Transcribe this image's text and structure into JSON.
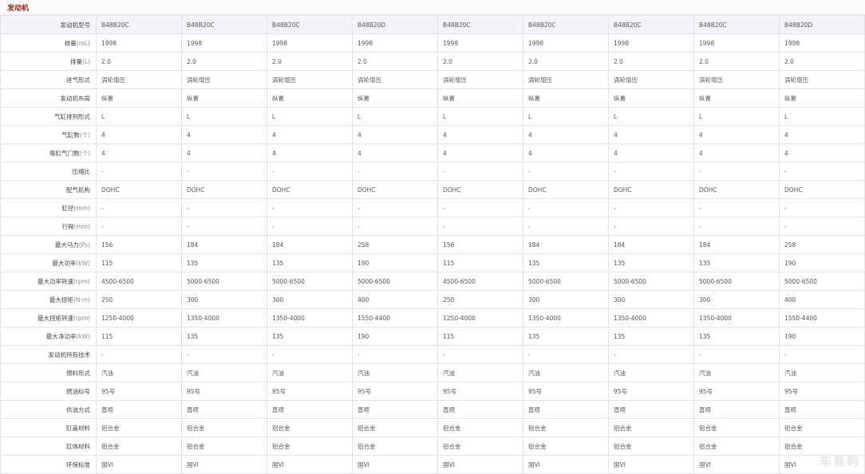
{
  "section": {
    "title": "发动机"
  },
  "watermark": "车易购",
  "rows": [
    {
      "label": "发动机型号",
      "unit": "",
      "values": [
        "B48B20C",
        "B48B20C",
        "B48B20C",
        "B48B20D",
        "B48B20C",
        "B48B20C",
        "B48B20C",
        "B48B20C",
        "B48B20D"
      ]
    },
    {
      "label": "排量",
      "unit": "(mL)",
      "values": [
        "1998",
        "1998",
        "1998",
        "1998",
        "1998",
        "1998",
        "1998",
        "1998",
        "1998"
      ]
    },
    {
      "label": "排量",
      "unit": "(L)",
      "values": [
        "2.0",
        "2.0",
        "2.0",
        "2.0",
        "2.0",
        "2.0",
        "2.0",
        "2.0",
        "2.0"
      ]
    },
    {
      "label": "进气形式",
      "unit": "",
      "values": [
        "涡轮增压",
        "涡轮增压",
        "涡轮增压",
        "涡轮增压",
        "涡轮增压",
        "涡轮增压",
        "涡轮增压",
        "涡轮增压",
        "涡轮增压"
      ]
    },
    {
      "label": "发动机布局",
      "unit": "",
      "values": [
        "纵置",
        "纵置",
        "纵置",
        "纵置",
        "纵置",
        "纵置",
        "纵置",
        "纵置",
        "纵置"
      ]
    },
    {
      "label": "气缸排列形式",
      "unit": "",
      "values": [
        "L",
        "L",
        "L",
        "L",
        "L",
        "L",
        "L",
        "L",
        "L"
      ]
    },
    {
      "label": "气缸数",
      "unit": "(个)",
      "values": [
        "4",
        "4",
        "4",
        "4",
        "4",
        "4",
        "4",
        "4",
        "4"
      ]
    },
    {
      "label": "每缸气门数",
      "unit": "(个)",
      "values": [
        "4",
        "4",
        "4",
        "4",
        "4",
        "4",
        "4",
        "4",
        "4"
      ]
    },
    {
      "label": "压缩比",
      "unit": "",
      "values": [
        "-",
        "-",
        "-",
        "-",
        "-",
        "-",
        "-",
        "-",
        "-"
      ]
    },
    {
      "label": "配气机构",
      "unit": "",
      "values": [
        "DOHC",
        "DOHC",
        "DOHC",
        "DOHC",
        "DOHC",
        "DOHC",
        "DOHC",
        "DOHC",
        "DOHC"
      ]
    },
    {
      "label": "缸径",
      "unit": "(mm)",
      "values": [
        "-",
        "-",
        "-",
        "-",
        "-",
        "-",
        "-",
        "-",
        "-"
      ]
    },
    {
      "label": "行程",
      "unit": "(mm)",
      "values": [
        "-",
        "-",
        "-",
        "-",
        "-",
        "-",
        "-",
        "-",
        "-"
      ]
    },
    {
      "label": "最大马力",
      "unit": "(Ps)",
      "values": [
        "156",
        "184",
        "184",
        "258",
        "156",
        "184",
        "184",
        "184",
        "258"
      ]
    },
    {
      "label": "最大功率",
      "unit": "(kW)",
      "values": [
        "115",
        "135",
        "135",
        "190",
        "115",
        "135",
        "135",
        "135",
        "190"
      ]
    },
    {
      "label": "最大功率转速",
      "unit": "(rpm)",
      "values": [
        "4500-6500",
        "5000-6500",
        "5000-6500",
        "5000-6500",
        "4500-6500",
        "5000-6500",
        "5000-6500",
        "5000-6500",
        "5000-6500"
      ]
    },
    {
      "label": "最大扭矩",
      "unit": "(N·m)",
      "values": [
        "250",
        "300",
        "300",
        "400",
        "250",
        "300",
        "300",
        "300",
        "400"
      ]
    },
    {
      "label": "最大扭矩转速",
      "unit": "(rpm)",
      "values": [
        "1250-4000",
        "1350-4000",
        "1350-4000",
        "1550-4400",
        "1250-4000",
        "1350-4000",
        "1350-4000",
        "1350-4000",
        "1550-4400"
      ]
    },
    {
      "label": "最大净功率",
      "unit": "(kW)",
      "values": [
        "115",
        "135",
        "135",
        "190",
        "115",
        "135",
        "135",
        "135",
        "190"
      ]
    },
    {
      "label": "发动机特有技术",
      "unit": "",
      "values": [
        "-",
        "-",
        "-",
        "-",
        "-",
        "-",
        "-",
        "-",
        "-"
      ]
    },
    {
      "label": "燃料形式",
      "unit": "",
      "values": [
        "汽油",
        "汽油",
        "汽油",
        "汽油",
        "汽油",
        "汽油",
        "汽油",
        "汽油",
        "汽油"
      ]
    },
    {
      "label": "燃油标号",
      "unit": "",
      "values": [
        "95号",
        "95号",
        "95号",
        "95号",
        "95号",
        "95号",
        "95号",
        "95号",
        "95号"
      ]
    },
    {
      "label": "供油方式",
      "unit": "",
      "values": [
        "直喷",
        "直喷",
        "直喷",
        "直喷",
        "直喷",
        "直喷",
        "直喷",
        "直喷",
        "直喷"
      ]
    },
    {
      "label": "缸盖材料",
      "unit": "",
      "values": [
        "铝合金",
        "铝合金",
        "铝合金",
        "铝合金",
        "铝合金",
        "铝合金",
        "铝合金",
        "铝合金",
        "铝合金"
      ]
    },
    {
      "label": "缸体材料",
      "unit": "",
      "values": [
        "铝合金",
        "铝合金",
        "铝合金",
        "铝合金",
        "铝合金",
        "铝合金",
        "铝合金",
        "铝合金",
        "铝合金"
      ]
    },
    {
      "label": "环保标准",
      "unit": "",
      "values": [
        "国VI",
        "国VI",
        "国VI",
        "国VI",
        "国VI",
        "国VI",
        "国VI",
        "国VI",
        "国VI"
      ]
    }
  ]
}
